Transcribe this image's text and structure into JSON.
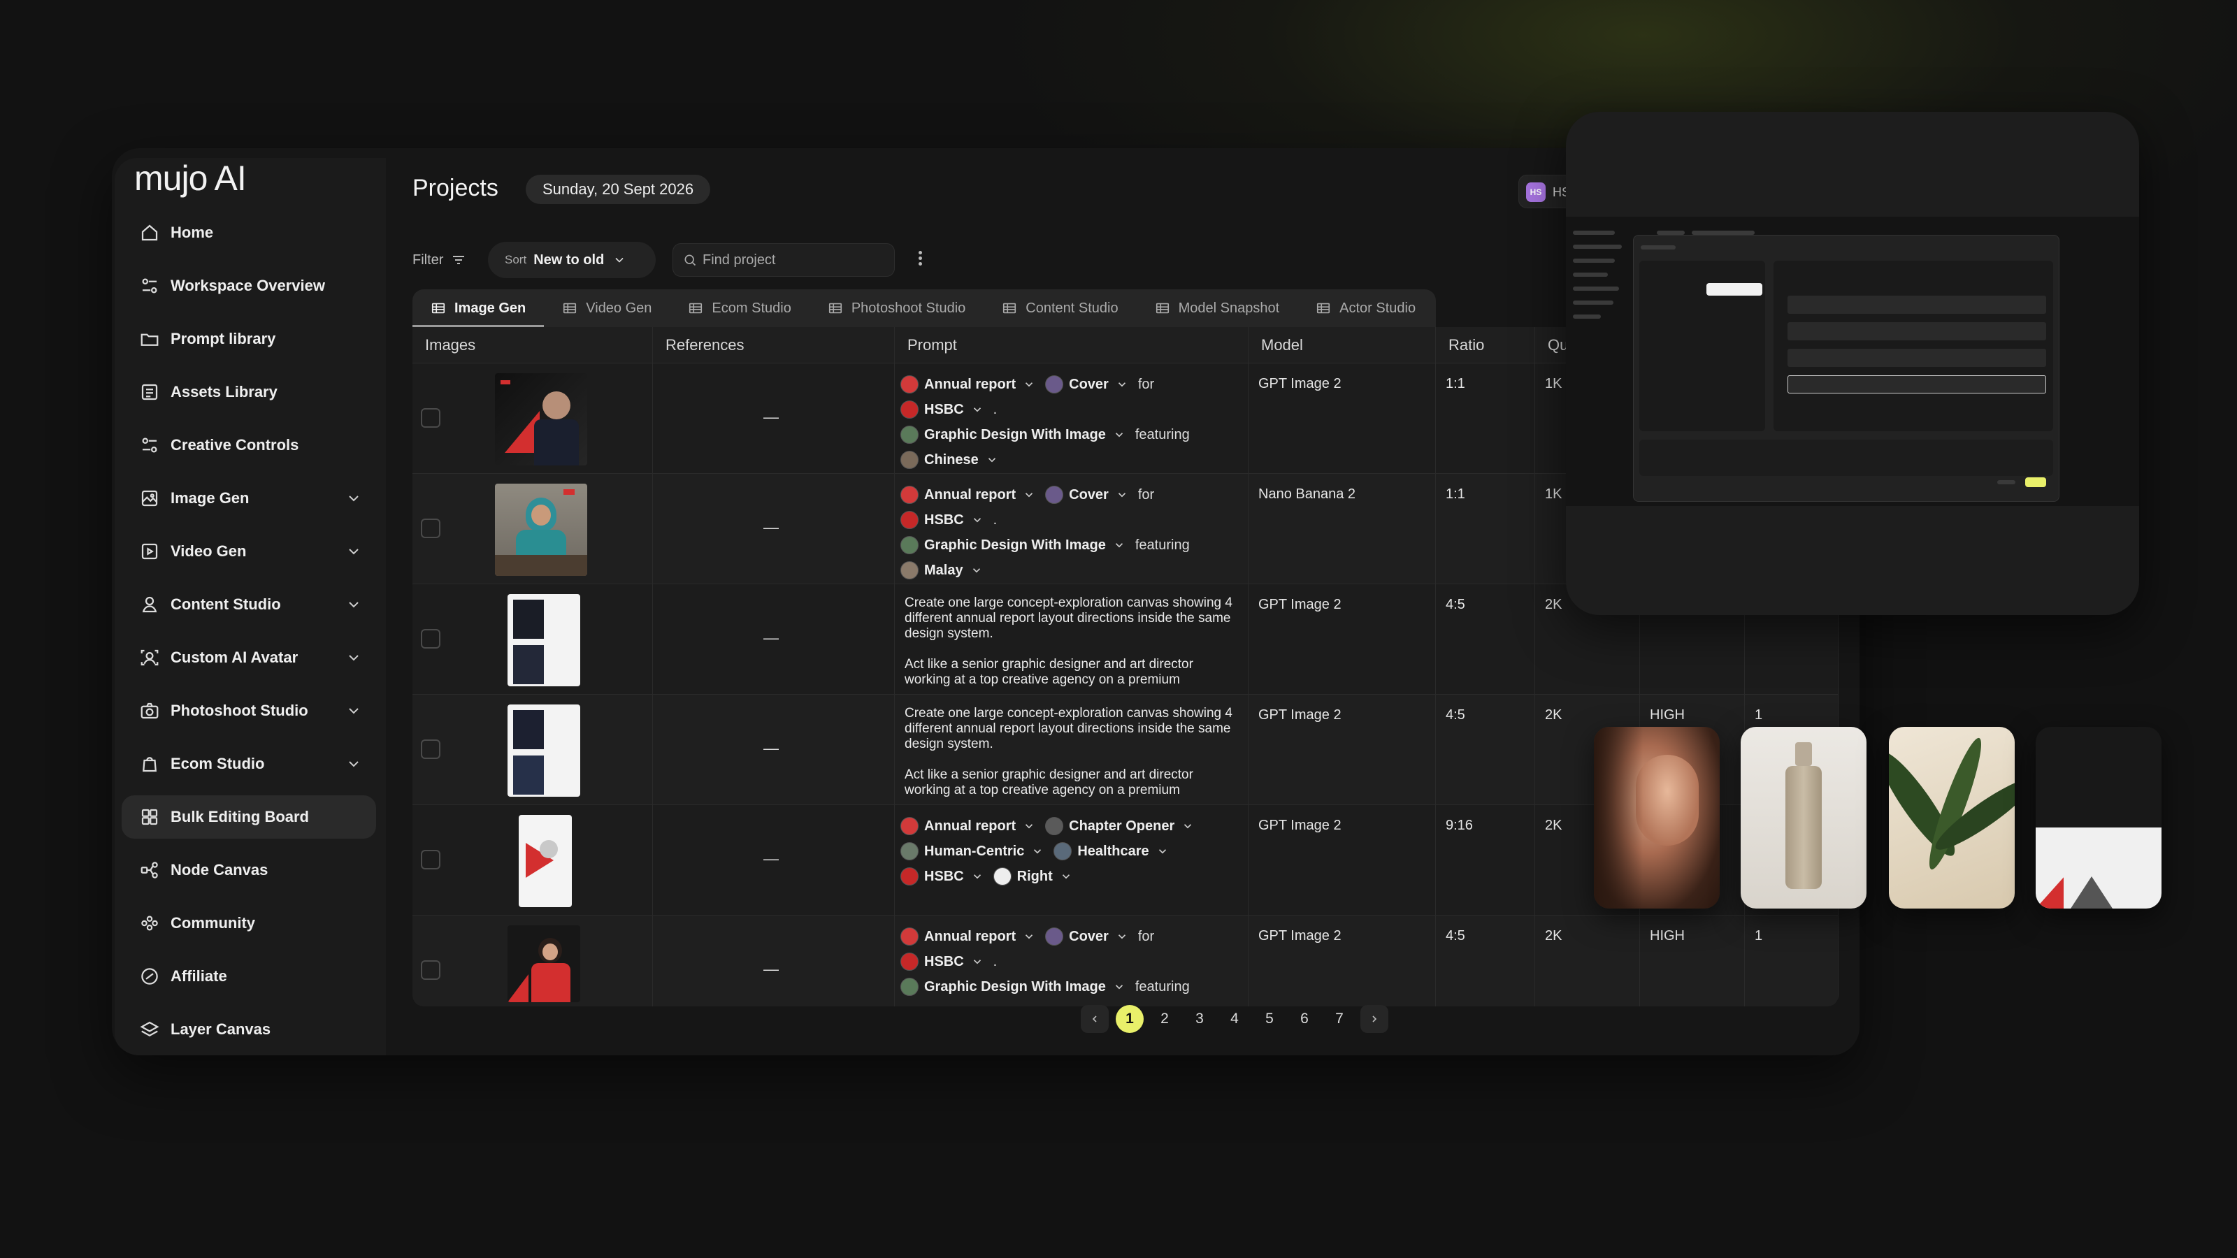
{
  "brand": {
    "logo_text": "mujo AI",
    "accent": "#e9f06a"
  },
  "sidebar": {
    "items": [
      {
        "label": "Home",
        "icon": "home-icon",
        "has_chevron": false
      },
      {
        "label": "Workspace Overview",
        "icon": "workspace-icon",
        "has_chevron": false
      },
      {
        "label": "Prompt library",
        "icon": "folder-icon",
        "has_chevron": false
      },
      {
        "label": "Assets Library",
        "icon": "assets-icon",
        "has_chevron": false
      },
      {
        "label": "Creative Controls",
        "icon": "controls-icon",
        "has_chevron": false
      },
      {
        "label": "Image Gen",
        "icon": "image-icon",
        "has_chevron": true
      },
      {
        "label": "Video Gen",
        "icon": "video-icon",
        "has_chevron": true
      },
      {
        "label": "Content Studio",
        "icon": "user-icon",
        "has_chevron": true
      },
      {
        "label": "Custom AI Avatar",
        "icon": "avatar-icon",
        "has_chevron": true
      },
      {
        "label": "Photoshoot Studio",
        "icon": "camera-icon",
        "has_chevron": true
      },
      {
        "label": "Ecom Studio",
        "icon": "bag-icon",
        "has_chevron": true
      },
      {
        "label": "Bulk Editing Board",
        "icon": "grid-icon",
        "has_chevron": false,
        "active": true
      },
      {
        "label": "Node Canvas",
        "icon": "node-icon",
        "has_chevron": false
      },
      {
        "label": "Community",
        "icon": "community-icon",
        "has_chevron": false
      },
      {
        "label": "Affiliate",
        "icon": "affiliate-icon",
        "has_chevron": false
      },
      {
        "label": "Layer Canvas",
        "icon": "layers-icon",
        "has_chevron": false
      }
    ]
  },
  "header": {
    "title": "Projects",
    "date": "Sunday, 20 Sept 2026",
    "workspace_initials": "HS",
    "workspace_name": "HSI"
  },
  "toolbar": {
    "filter_label": "Filter",
    "sort_label": "Sort",
    "sort_value": "New to old",
    "search_placeholder": "Find project"
  },
  "tabs": [
    {
      "label": "Image Gen",
      "active": true
    },
    {
      "label": "Video Gen"
    },
    {
      "label": "Ecom Studio"
    },
    {
      "label": "Photoshoot Studio"
    },
    {
      "label": "Content Studio"
    },
    {
      "label": "Model Snapshot"
    },
    {
      "label": "Actor Studio"
    }
  ],
  "table": {
    "columns": [
      "Images",
      "References",
      "Prompt",
      "Model",
      "Ratio",
      "Qu"
    ],
    "rows": [
      {
        "reference": "—",
        "prompt_lines": [
          [
            {
              "type": "chip",
              "text": "Annual report",
              "color": "#d23a3a"
            },
            {
              "type": "chip",
              "text": "Cover",
              "color": "#6a5a8a"
            },
            {
              "type": "text",
              "text": "for"
            }
          ],
          [
            {
              "type": "chip",
              "text": "HSBC",
              "color": "#c62828"
            },
            {
              "type": "text",
              "text": "."
            }
          ],
          [
            {
              "type": "chip",
              "text": "Graphic Design With Image",
              "color": "#5a7a5a"
            },
            {
              "type": "text",
              "text": "featuring"
            }
          ],
          [
            {
              "type": "chip",
              "text": "Chinese",
              "color": "#7a6a5a"
            }
          ]
        ],
        "model": "GPT Image 2",
        "ratio": "1:1",
        "quality": "1K",
        "level": "",
        "count": ""
      },
      {
        "reference": "—",
        "prompt_lines": [
          [
            {
              "type": "chip",
              "text": "Annual report",
              "color": "#d23a3a"
            },
            {
              "type": "chip",
              "text": "Cover",
              "color": "#6a5a8a"
            },
            {
              "type": "text",
              "text": "for"
            }
          ],
          [
            {
              "type": "chip",
              "text": "HSBC",
              "color": "#c62828"
            },
            {
              "type": "text",
              "text": "."
            }
          ],
          [
            {
              "type": "chip",
              "text": "Graphic Design With Image",
              "color": "#5a7a5a"
            },
            {
              "type": "text",
              "text": "featuring"
            }
          ],
          [
            {
              "type": "chip",
              "text": "Malay",
              "color": "#8a7a6a"
            }
          ]
        ],
        "model": "Nano Banana 2",
        "ratio": "1:1",
        "quality": "1K",
        "level": "",
        "count": ""
      },
      {
        "reference": "—",
        "prompt_text": [
          "Create one large concept-exploration canvas showing 4 different annual report layout directions inside the same design system.",
          "Act like a senior graphic designer and art director working at a top creative agency on a premium"
        ],
        "model": "GPT Image 2",
        "ratio": "4:5",
        "quality": "2K",
        "level": "",
        "count": ""
      },
      {
        "reference": "—",
        "prompt_text": [
          "Create one large concept-exploration canvas showing 4 different annual report layout directions inside the same design system.",
          "Act like a senior graphic designer and art director working at a top creative agency on a premium"
        ],
        "model": "GPT Image 2",
        "ratio": "4:5",
        "quality": "2K",
        "level": "HIGH",
        "count": "1"
      },
      {
        "reference": "—",
        "prompt_lines": [
          [
            {
              "type": "chip",
              "text": "Annual report",
              "color": "#d23a3a"
            },
            {
              "type": "chip",
              "text": "Chapter Opener",
              "color": "#5a5a5a"
            }
          ],
          [
            {
              "type": "chip",
              "text": "Human-Centric",
              "color": "#6a7a6a"
            },
            {
              "type": "chip",
              "text": "Healthcare",
              "color": "#5a6a7a"
            }
          ],
          [
            {
              "type": "chip",
              "text": "HSBC",
              "color": "#c62828"
            },
            {
              "type": "chip",
              "text": "Right",
              "color": "#eeeeee"
            }
          ]
        ],
        "model": "GPT Image 2",
        "ratio": "9:16",
        "quality": "2K",
        "level": "",
        "count": ""
      },
      {
        "reference": "—",
        "prompt_lines": [
          [
            {
              "type": "chip",
              "text": "Annual report",
              "color": "#d23a3a"
            },
            {
              "type": "chip",
              "text": "Cover",
              "color": "#6a5a8a"
            },
            {
              "type": "text",
              "text": "for"
            }
          ],
          [
            {
              "type": "chip",
              "text": "HSBC",
              "color": "#c62828"
            },
            {
              "type": "text",
              "text": "."
            }
          ],
          [
            {
              "type": "chip",
              "text": "Graphic Design With Image",
              "color": "#5a7a5a"
            },
            {
              "type": "text",
              "text": "featuring"
            }
          ]
        ],
        "model": "GPT Image 2",
        "ratio": "4:5",
        "quality": "2K",
        "level": "HIGH",
        "count": "1"
      }
    ]
  },
  "pagination": {
    "pages": [
      "1",
      "2",
      "3",
      "4",
      "5",
      "6",
      "7"
    ],
    "current": "1"
  }
}
